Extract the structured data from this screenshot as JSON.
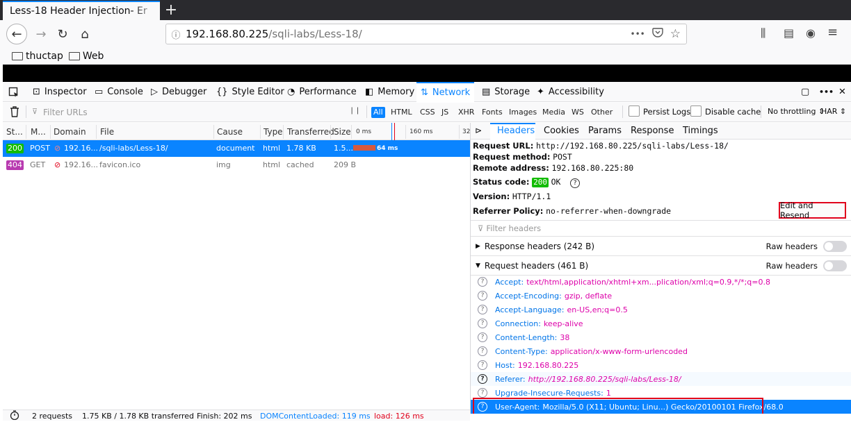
{
  "browser": {
    "tab_title": "Less-18 Header Injection- Er",
    "tab_close": "×",
    "new_tab": "+",
    "url_info_icon": "ⓘ",
    "url_host": "192.168.80.225",
    "url_path": "/sqli-labs/Less-18/",
    "url_more": "•••",
    "pocket_icon": "pocket-icon",
    "star_icon": "☆",
    "icons": {
      "back": "←",
      "forward": "→",
      "reload": "↻",
      "home": "⌂",
      "library": "⫼",
      "sidebar": "▤",
      "account": "◉",
      "menu": "≡"
    },
    "bookmarks": [
      "thuctap",
      "Web"
    ]
  },
  "devtools": {
    "tabs": {
      "inspector": "Inspector",
      "console": "Console",
      "debugger": "Debugger",
      "style_editor": "Style Editor",
      "performance": "Performance",
      "memory": "Memory",
      "network": "Network",
      "storage": "Storage",
      "accessibility": "Accessibility"
    },
    "toolbar_icons": {
      "dock": "▢",
      "more": "•••",
      "close": "✕"
    },
    "network": {
      "filter_placeholder": "Filter URLs",
      "pause": "❘❘",
      "filters": [
        "All",
        "HTML",
        "CSS",
        "JS",
        "XHR",
        "Fonts",
        "Images",
        "Media",
        "WS",
        "Other"
      ],
      "persist_logs": "Persist Logs",
      "disable_cache": "Disable cache",
      "throttling": "No throttling ⇕",
      "har": "HAR ⇕",
      "columns": {
        "status": "St...",
        "method": "M...",
        "domain": "Domain",
        "file": "File",
        "cause": "Cause",
        "type": "Type",
        "transferred": "Transferred",
        "size": "Size"
      },
      "timeline_ticks": [
        "0 ms",
        "160 ms",
        "32"
      ],
      "requests": [
        {
          "status": "200",
          "method": "POST",
          "domain": "192.16...",
          "file": "/sqli-labs/Less-18/",
          "cause": "document",
          "type": "html",
          "transferred": "1.78 KB",
          "size": "1.5...",
          "timing": "64 ms"
        },
        {
          "status": "404",
          "method": "GET",
          "domain": "192.16...",
          "file": "favicon.ico",
          "cause": "img",
          "type": "html",
          "transferred": "cached",
          "size": "209 B",
          "timing": ""
        }
      ],
      "status_bar": {
        "requests": "2 requests",
        "transferred": "1.75 KB / 1.78 KB transferred",
        "finish": "Finish: 202 ms",
        "dom_loaded": "DOMContentLoaded: 119 ms",
        "load": "load: 126 ms"
      }
    },
    "details": {
      "tabs": [
        "Headers",
        "Cookies",
        "Params",
        "Response",
        "Timings"
      ],
      "request_url_label": "Request URL:",
      "request_url": "http://192.168.80.225/sqli-labs/Less-18/",
      "request_method_label": "Request method:",
      "request_method": "POST",
      "remote_address_label": "Remote address:",
      "remote_address": "192.168.80.225:80",
      "status_code_label": "Status code:",
      "status_code": "200",
      "status_text": "OK",
      "version_label": "Version:",
      "version": "HTTP/1.1",
      "referrer_policy_label": "Referrer Policy:",
      "referrer_policy": "no-referrer-when-downgrade",
      "edit_resend": "Edit and Resend",
      "filter_headers": "Filter headers",
      "response_headers": "Response headers (242 B)",
      "request_headers": "Request headers (461 B)",
      "raw_headers": "Raw headers",
      "headers": [
        {
          "name": "Accept:",
          "value": "text/html,application/xhtml+xm...plication/xml;q=0.9,*/*;q=0.8"
        },
        {
          "name": "Accept-Encoding:",
          "value": "gzip, deflate"
        },
        {
          "name": "Accept-Language:",
          "value": "en-US,en;q=0.5"
        },
        {
          "name": "Connection:",
          "value": "keep-alive"
        },
        {
          "name": "Content-Length:",
          "value": "38"
        },
        {
          "name": "Content-Type:",
          "value": "application/x-www-form-urlencoded"
        },
        {
          "name": "Host:",
          "value": "192.168.80.225"
        },
        {
          "name": "Referer:",
          "value": "http://192.168.80.225/sqli-labs/Less-18/"
        },
        {
          "name": "Upgrade-Insecure-Requests:",
          "value": "1"
        },
        {
          "name": "User-Agent:",
          "value": "Mozilla/5.0 (X11; Ubuntu; Linu...) Gecko/20100101 Firefox/68.0"
        }
      ]
    }
  }
}
